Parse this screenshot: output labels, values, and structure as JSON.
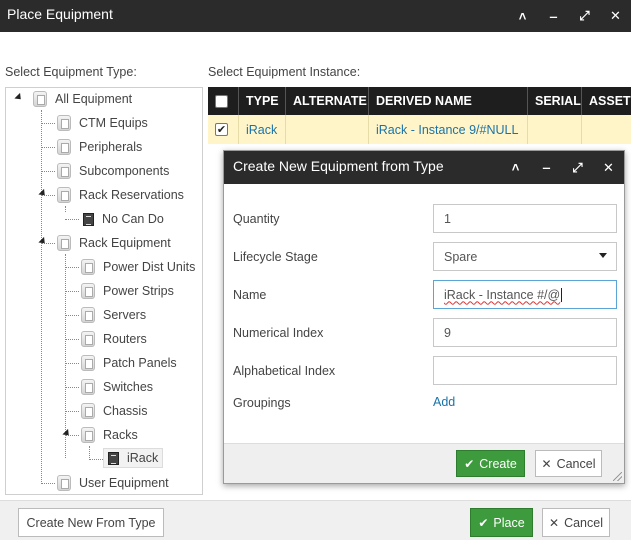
{
  "window": {
    "title": "Place Equipment",
    "buttons": [
      "chevron-up",
      "minimize",
      "expand",
      "close"
    ]
  },
  "left_panel": {
    "label": "Select Equipment Type:",
    "tree": [
      {
        "label": "All Equipment",
        "icon": "folder"
      },
      {
        "label": "CTM Equips",
        "icon": "folder"
      },
      {
        "label": "Peripherals",
        "icon": "folder"
      },
      {
        "label": "Subcomponents",
        "icon": "folder"
      },
      {
        "label": "Rack Reservations",
        "icon": "folder"
      },
      {
        "label": "No Can Do",
        "icon": "equipment"
      },
      {
        "label": "Rack Equipment",
        "icon": "folder"
      },
      {
        "label": "Power Dist Units",
        "icon": "folder"
      },
      {
        "label": "Power Strips",
        "icon": "folder"
      },
      {
        "label": "Servers",
        "icon": "folder"
      },
      {
        "label": "Routers",
        "icon": "folder"
      },
      {
        "label": "Patch Panels",
        "icon": "folder"
      },
      {
        "label": "Switches",
        "icon": "folder"
      },
      {
        "label": "Chassis",
        "icon": "folder"
      },
      {
        "label": "Racks",
        "icon": "folder"
      },
      {
        "label": "iRack",
        "icon": "equipment"
      },
      {
        "label": "User Equipment",
        "icon": "folder"
      }
    ]
  },
  "right_panel": {
    "label": "Select Equipment Instance:",
    "columns": [
      "TYPE",
      "ALTERNATE",
      "DERIVED NAME",
      "SERIAL",
      "ASSET"
    ],
    "rows": [
      {
        "type": "iRack",
        "alternate": "",
        "derived_name": "iRack - Instance 9/#NULL",
        "serial": "",
        "asset": "",
        "checked": true
      }
    ]
  },
  "modal": {
    "title": "Create New Equipment from Type",
    "fields": {
      "quantity": {
        "label": "Quantity",
        "value": "1"
      },
      "lifecycle": {
        "label": "Lifecycle Stage",
        "value": "Spare"
      },
      "name": {
        "label": "Name",
        "value": "iRack - Instance #/@"
      },
      "numerical_index": {
        "label": "Numerical Index",
        "value": "9"
      },
      "alphabetical_index": {
        "label": "Alphabetical Index",
        "value": ""
      },
      "groupings": {
        "label": "Groupings",
        "link": "Add"
      }
    },
    "create_label": "Create",
    "cancel_label": "Cancel"
  },
  "footer": {
    "create_new_label": "Create New From Type",
    "place_label": "Place",
    "cancel_label": "Cancel"
  },
  "colors": {
    "titlebar": "#2b2b2b",
    "accent_green": "#3d9b3d",
    "link_blue": "#1a73a8",
    "selected_row": "#fff5c9"
  }
}
